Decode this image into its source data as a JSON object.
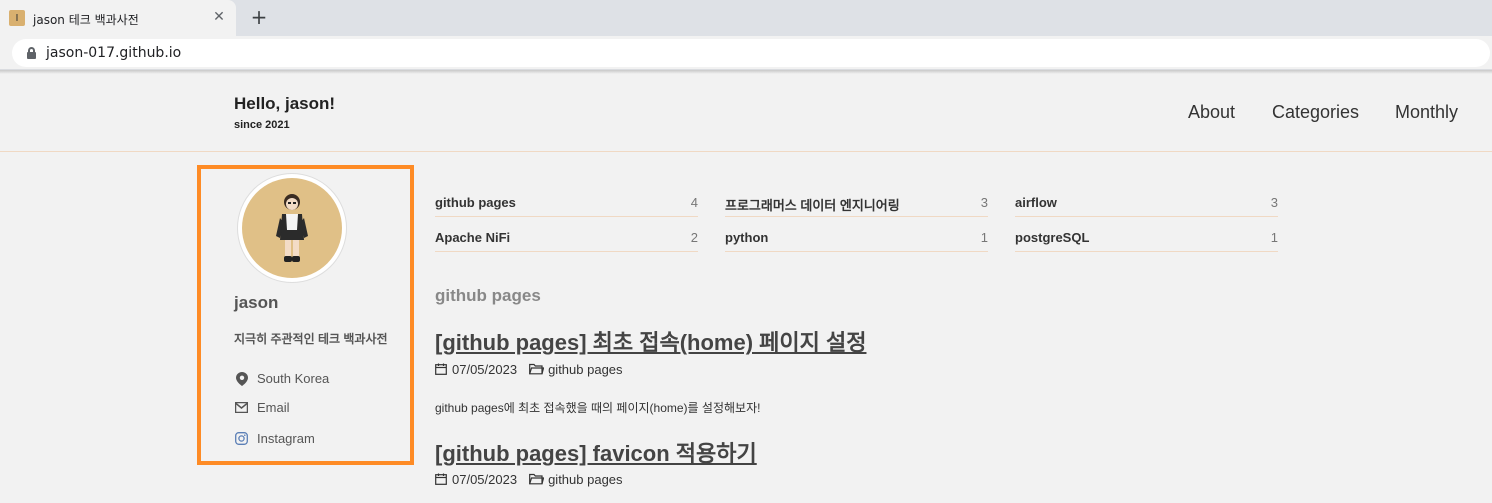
{
  "browser": {
    "tab_title": "jason 테크 백과사전",
    "favicon_glyph": "Ⅰ",
    "close_glyph": "✕",
    "new_tab_glyph": "+",
    "url": "jason-017.github.io"
  },
  "header": {
    "title": "Hello, jason!",
    "subtitle": "since 2021",
    "nav": [
      "About",
      "Categories",
      "Monthly"
    ]
  },
  "sidebar": {
    "name": "jason",
    "bio": "지극히 주관적인 테크 백과사전",
    "links": [
      {
        "label": "South Korea",
        "icon": "map-marker-icon"
      },
      {
        "label": "Email",
        "icon": "envelope-icon"
      },
      {
        "label": "Instagram",
        "icon": "instagram-icon"
      }
    ],
    "highlight_color": "#fe8b25"
  },
  "categories": [
    {
      "name": "github pages",
      "count": "4"
    },
    {
      "name": "프로그래머스 데이터 엔지니어링",
      "count": "3"
    },
    {
      "name": "airflow",
      "count": "3"
    },
    {
      "name": "Apache NiFi",
      "count": "2"
    },
    {
      "name": "python",
      "count": "1"
    },
    {
      "name": "postgreSQL",
      "count": "1"
    }
  ],
  "section_title": "github pages",
  "posts": [
    {
      "title": "[github pages] 최초 접속(home) 페이지 설정",
      "date": "07/05/2023",
      "category": "github pages",
      "excerpt": "github pages에 최초 접속했을 때의 페이지(home)를 설정해보자!"
    },
    {
      "title": "[github pages] favicon 적용하기",
      "date": "07/05/2023",
      "category": "github pages"
    }
  ]
}
